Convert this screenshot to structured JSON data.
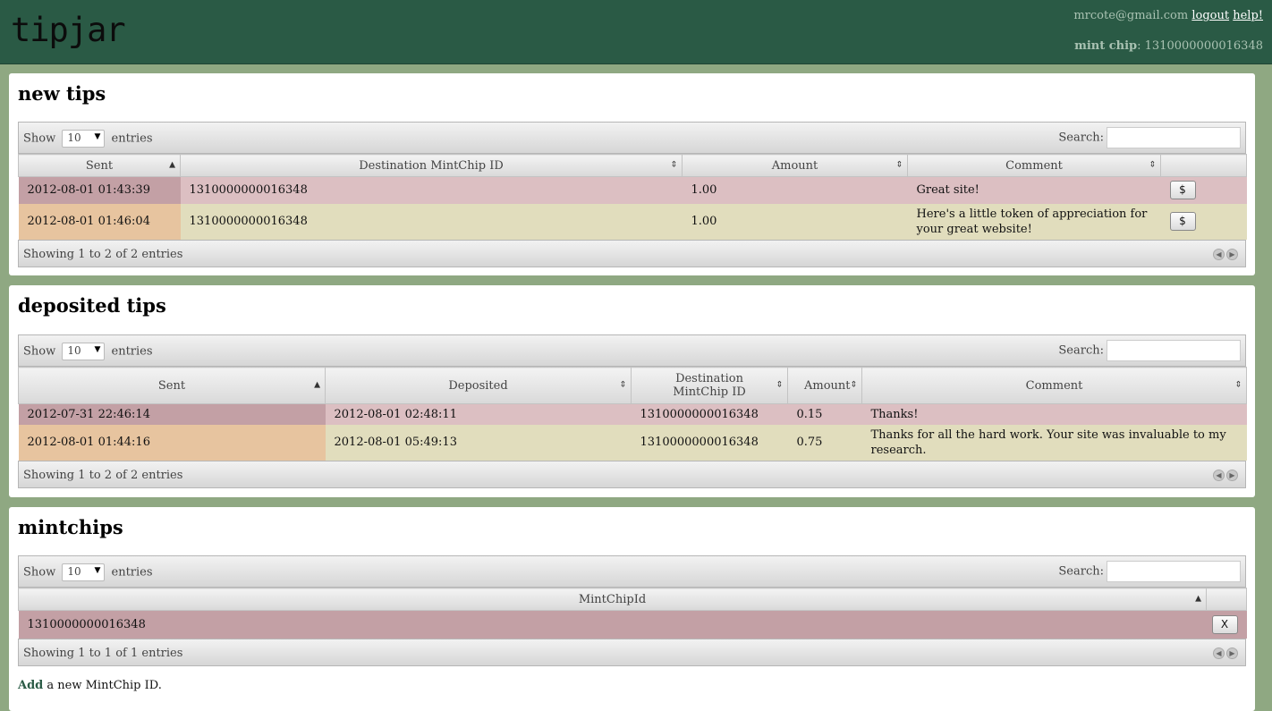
{
  "header": {
    "logo": "tipjar",
    "email": "mrcote@gmail.com",
    "logout": "logout",
    "help": "help!",
    "mint_label": "mint chip",
    "mint_id": "1310000000016348"
  },
  "common": {
    "show_label": "Show",
    "entries_label": "entries",
    "page_length": "10",
    "search_label": "Search:"
  },
  "new_tips": {
    "title": "new tips",
    "columns": [
      "Sent",
      "Destination MintChip ID",
      "Amount",
      "Comment"
    ],
    "rows": [
      {
        "sent": "2012-08-01 01:43:39",
        "dest": "1310000000016348",
        "amount": "1.00",
        "comment": "Great site!",
        "action": "$"
      },
      {
        "sent": "2012-08-01 01:46:04",
        "dest": "1310000000016348",
        "amount": "1.00",
        "comment": "Here's a little token of appreciation for your great website!",
        "action": "$"
      }
    ],
    "info": "Showing 1 to 2 of 2 entries"
  },
  "deposited_tips": {
    "title": "deposited tips",
    "columns": [
      "Sent",
      "Deposited",
      "Destination MintChip ID",
      "Amount",
      "Comment"
    ],
    "rows": [
      {
        "sent": "2012-07-31 22:46:14",
        "deposited": "2012-08-01 02:48:11",
        "dest": "1310000000016348",
        "amount": "0.15",
        "comment": "Thanks!"
      },
      {
        "sent": "2012-08-01 01:44:16",
        "deposited": "2012-08-01 05:49:13",
        "dest": "1310000000016348",
        "amount": "0.75",
        "comment": "Thanks for all the hard work. Your site was invaluable to my research."
      }
    ],
    "info": "Showing 1 to 2 of 2 entries"
  },
  "mintchips": {
    "title": "mintchips",
    "columns": [
      "MintChipId"
    ],
    "rows": [
      {
        "id": "1310000000016348",
        "action": "X"
      }
    ],
    "info": "Showing 1 to 1 of 1 entries",
    "add_link": "Add",
    "add_rest": " a new MintChip ID."
  }
}
